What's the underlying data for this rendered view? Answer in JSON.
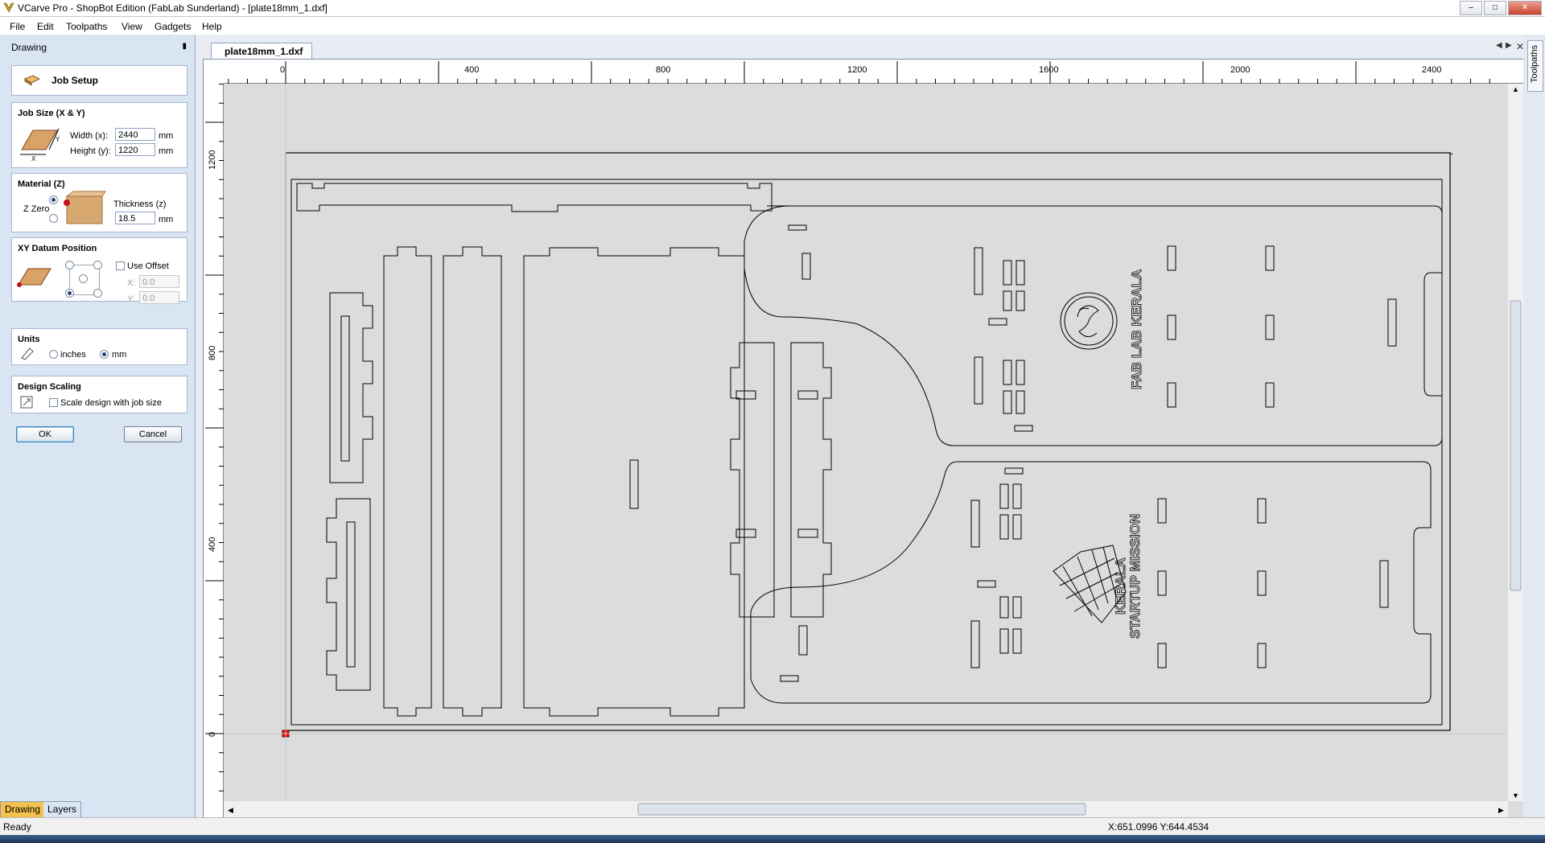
{
  "window": {
    "title": "VCarve Pro - ShopBot Edition (FabLab Sunderland) - [plate18mm_1.dxf]"
  },
  "menu": {
    "items": [
      "File",
      "Edit",
      "Toolpaths",
      "View",
      "Gadgets",
      "Help"
    ]
  },
  "panel": {
    "title": "Drawing",
    "job_setup": "Job Setup",
    "job_size": {
      "heading": "Job Size (X & Y)",
      "width_label": "Width (x):",
      "width_value": "2440",
      "height_label": "Height (y):",
      "height_value": "1220",
      "unit": "mm",
      "axis_x": "X",
      "axis_y": "Y"
    },
    "material": {
      "heading": "Material (Z)",
      "zzero_label": "Z Zero",
      "thickness_label": "Thickness (z)",
      "thickness_value": "18.5",
      "unit": "mm"
    },
    "datum": {
      "heading": "XY Datum Position",
      "use_offset": "Use Offset",
      "x_label": "X:",
      "x_value": "0.0",
      "y_label": "Y:",
      "y_value": "0.0"
    },
    "units": {
      "heading": "Units",
      "inches": "inches",
      "mm": "mm",
      "selected": "mm"
    },
    "scaling": {
      "heading": "Design Scaling",
      "label": "Scale design with job size"
    },
    "ok": "OK",
    "cancel": "Cancel"
  },
  "bottom_tabs": [
    "Drawing",
    "Layers"
  ],
  "document_tab": "plate18mm_1.dxf",
  "right_tab": "Toolpaths",
  "ruler": {
    "top_labels": [
      "0",
      "400",
      "800",
      "1200",
      "1600",
      "2000",
      "2400"
    ],
    "left_labels": [
      "1200",
      "800",
      "400",
      "0"
    ]
  },
  "drawing_text": {
    "logo1": "FAB LAB KERALA",
    "logo2_line1": "KERALA",
    "logo2_line2": "STARTUP MISSION"
  },
  "status": {
    "text": "Ready",
    "coords": "X:651.0996 Y:644.4534"
  },
  "colors": {
    "panel_bg": "#dae5f3",
    "canvas_bg": "#dcdcdc",
    "accent": "#f2c14e",
    "origin_marker": "#ff0000"
  }
}
